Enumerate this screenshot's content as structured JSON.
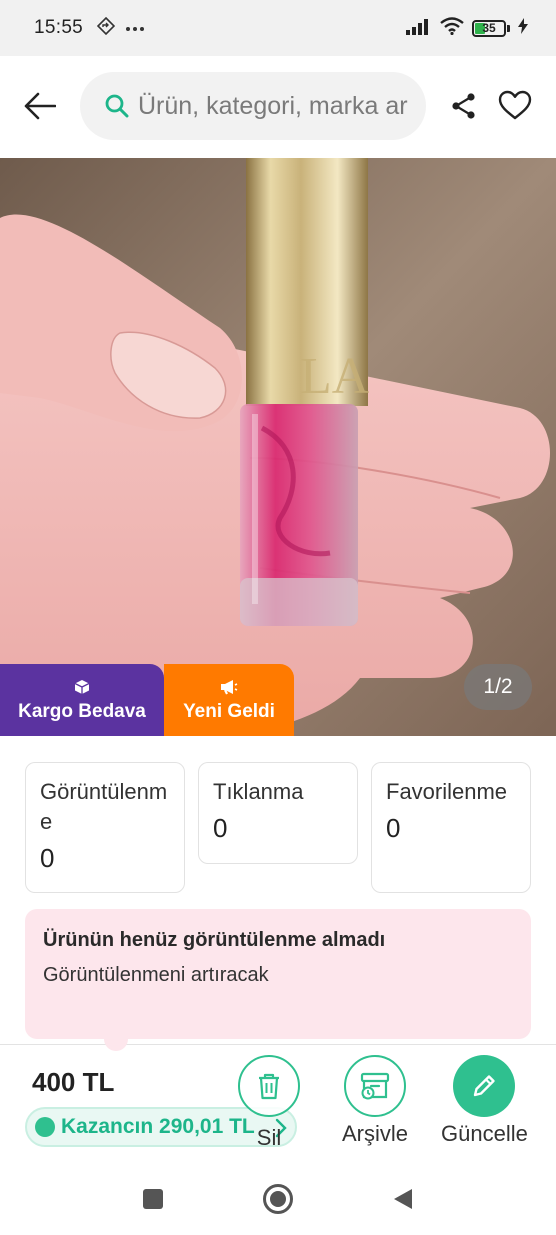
{
  "status_bar": {
    "time": "15:55",
    "battery_level": "35",
    "icons": [
      "navigation-icon",
      "more-icon",
      "signal-icon",
      "wifi-icon",
      "battery-icon",
      "charging-icon"
    ]
  },
  "header": {
    "search_placeholder": "Ürün, kategori, marka ara",
    "icons": [
      "back-arrow-icon",
      "search-icon",
      "share-icon",
      "heart-icon"
    ]
  },
  "product_image": {
    "pager": "1/2",
    "badges": [
      {
        "label": "Kargo Bedava",
        "icon": "box-icon",
        "color": "#5b33a0"
      },
      {
        "label": "Yeni Geldi",
        "icon": "megaphone-icon",
        "color": "#ff7a00"
      }
    ]
  },
  "stats": [
    {
      "label": "Görüntülenme",
      "value": "0"
    },
    {
      "label": "Tıklanma",
      "value": "0"
    },
    {
      "label": "Favorilenme",
      "value": "0"
    }
  ],
  "notice": {
    "title": "Ürünün henüz görüntülenme almadı",
    "subtitle": "Görüntülenmeni artıracak"
  },
  "bottom": {
    "price": "400 TL",
    "earnings": "Kazancın 290,01 TL",
    "actions": [
      {
        "label": "Sil",
        "icon": "trash-icon"
      },
      {
        "label": "Arşivle",
        "icon": "archive-icon"
      },
      {
        "label": "Güncelle",
        "icon": "pencil-icon"
      }
    ]
  },
  "colors": {
    "accent_green": "#2fc08f",
    "kargo_purple": "#5b33a0",
    "yeni_orange": "#ff7a00",
    "notice_pink": "#fde6ec"
  }
}
